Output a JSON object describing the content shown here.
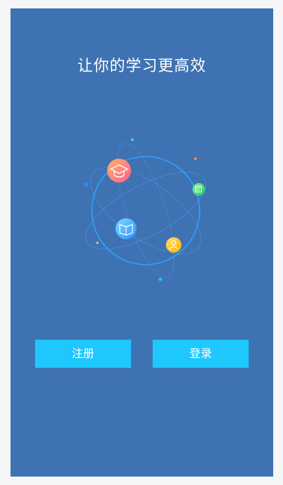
{
  "hero": {
    "title": "让你的学习更高效"
  },
  "actions": {
    "register_label": "注册",
    "login_label": "登录"
  },
  "colors": {
    "background": "#3f72b2",
    "page": "#f5f6f8",
    "button": "#1ec8ff",
    "orbit": "#2f9bff"
  },
  "illustration": {
    "icons": [
      "graduation-cap-icon",
      "certificate-icon",
      "open-book-icon",
      "user-icon"
    ]
  }
}
